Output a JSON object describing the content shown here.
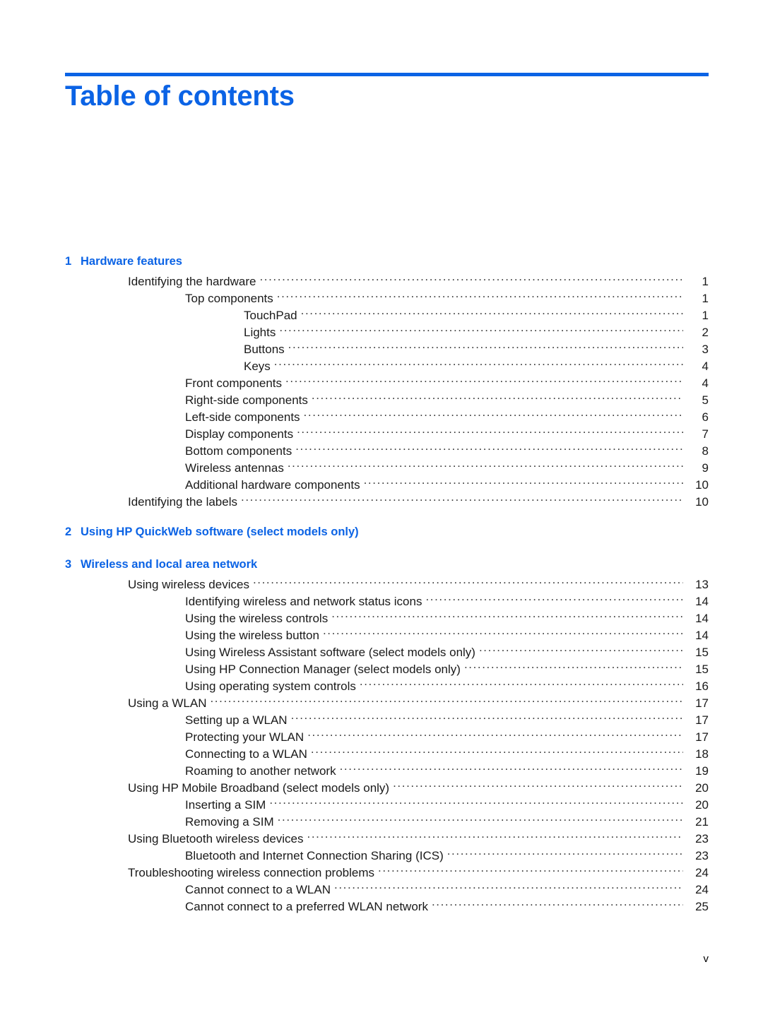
{
  "title": "Table of contents",
  "accent_color": "#0B63E5",
  "footer": {
    "page_number": "v"
  },
  "toc": {
    "chapters": [
      {
        "number": "1",
        "title": "Hardware features",
        "entries": [
          {
            "level": 1,
            "text": "Identifying the hardware",
            "page": "1"
          },
          {
            "level": 2,
            "text": "Top components",
            "page": "1"
          },
          {
            "level": 3,
            "text": "TouchPad",
            "page": "1"
          },
          {
            "level": 3,
            "text": "Lights",
            "page": "2"
          },
          {
            "level": 3,
            "text": "Buttons",
            "page": "3"
          },
          {
            "level": 3,
            "text": "Keys",
            "page": "4"
          },
          {
            "level": 2,
            "text": "Front components",
            "page": "4"
          },
          {
            "level": 2,
            "text": "Right-side components",
            "page": "5"
          },
          {
            "level": 2,
            "text": "Left-side components",
            "page": "6"
          },
          {
            "level": 2,
            "text": "Display components",
            "page": "7"
          },
          {
            "level": 2,
            "text": "Bottom components",
            "page": "8"
          },
          {
            "level": 2,
            "text": "Wireless antennas",
            "page": "9"
          },
          {
            "level": 2,
            "text": "Additional hardware components",
            "page": "10"
          },
          {
            "level": 1,
            "text": "Identifying the labels",
            "page": "10"
          }
        ]
      },
      {
        "number": "2",
        "title": "Using HP QuickWeb software (select models only)",
        "entries": []
      },
      {
        "number": "3",
        "title": "Wireless and local area network",
        "entries": [
          {
            "level": 1,
            "text": "Using wireless devices",
            "page": "13"
          },
          {
            "level": 2,
            "text": "Identifying wireless and network status icons",
            "page": "14"
          },
          {
            "level": 2,
            "text": "Using the wireless controls",
            "page": "14"
          },
          {
            "level": 2,
            "text": "Using the wireless button",
            "page": "14"
          },
          {
            "level": 2,
            "text": "Using Wireless Assistant software (select models only)",
            "page": "15"
          },
          {
            "level": 2,
            "text": "Using HP Connection Manager (select models only)",
            "page": "15"
          },
          {
            "level": 2,
            "text": "Using operating system controls",
            "page": "16"
          },
          {
            "level": 1,
            "text": "Using a WLAN",
            "page": "17"
          },
          {
            "level": 2,
            "text": "Setting up a WLAN",
            "page": "17"
          },
          {
            "level": 2,
            "text": "Protecting your WLAN",
            "page": "17"
          },
          {
            "level": 2,
            "text": "Connecting to a WLAN",
            "page": "18"
          },
          {
            "level": 2,
            "text": "Roaming to another network",
            "page": "19"
          },
          {
            "level": 1,
            "text": "Using HP Mobile Broadband (select models only)",
            "page": "20"
          },
          {
            "level": 2,
            "text": "Inserting a SIM",
            "page": "20"
          },
          {
            "level": 2,
            "text": "Removing a SIM",
            "page": "21"
          },
          {
            "level": 1,
            "text": "Using Bluetooth wireless devices",
            "page": "23"
          },
          {
            "level": 2,
            "text": "Bluetooth and Internet Connection Sharing (ICS)",
            "page": "23"
          },
          {
            "level": 1,
            "text": "Troubleshooting wireless connection problems",
            "page": "24"
          },
          {
            "level": 2,
            "text": "Cannot connect to a WLAN",
            "page": "24"
          },
          {
            "level": 2,
            "text": "Cannot connect to a preferred WLAN network",
            "page": "25"
          }
        ]
      }
    ]
  }
}
